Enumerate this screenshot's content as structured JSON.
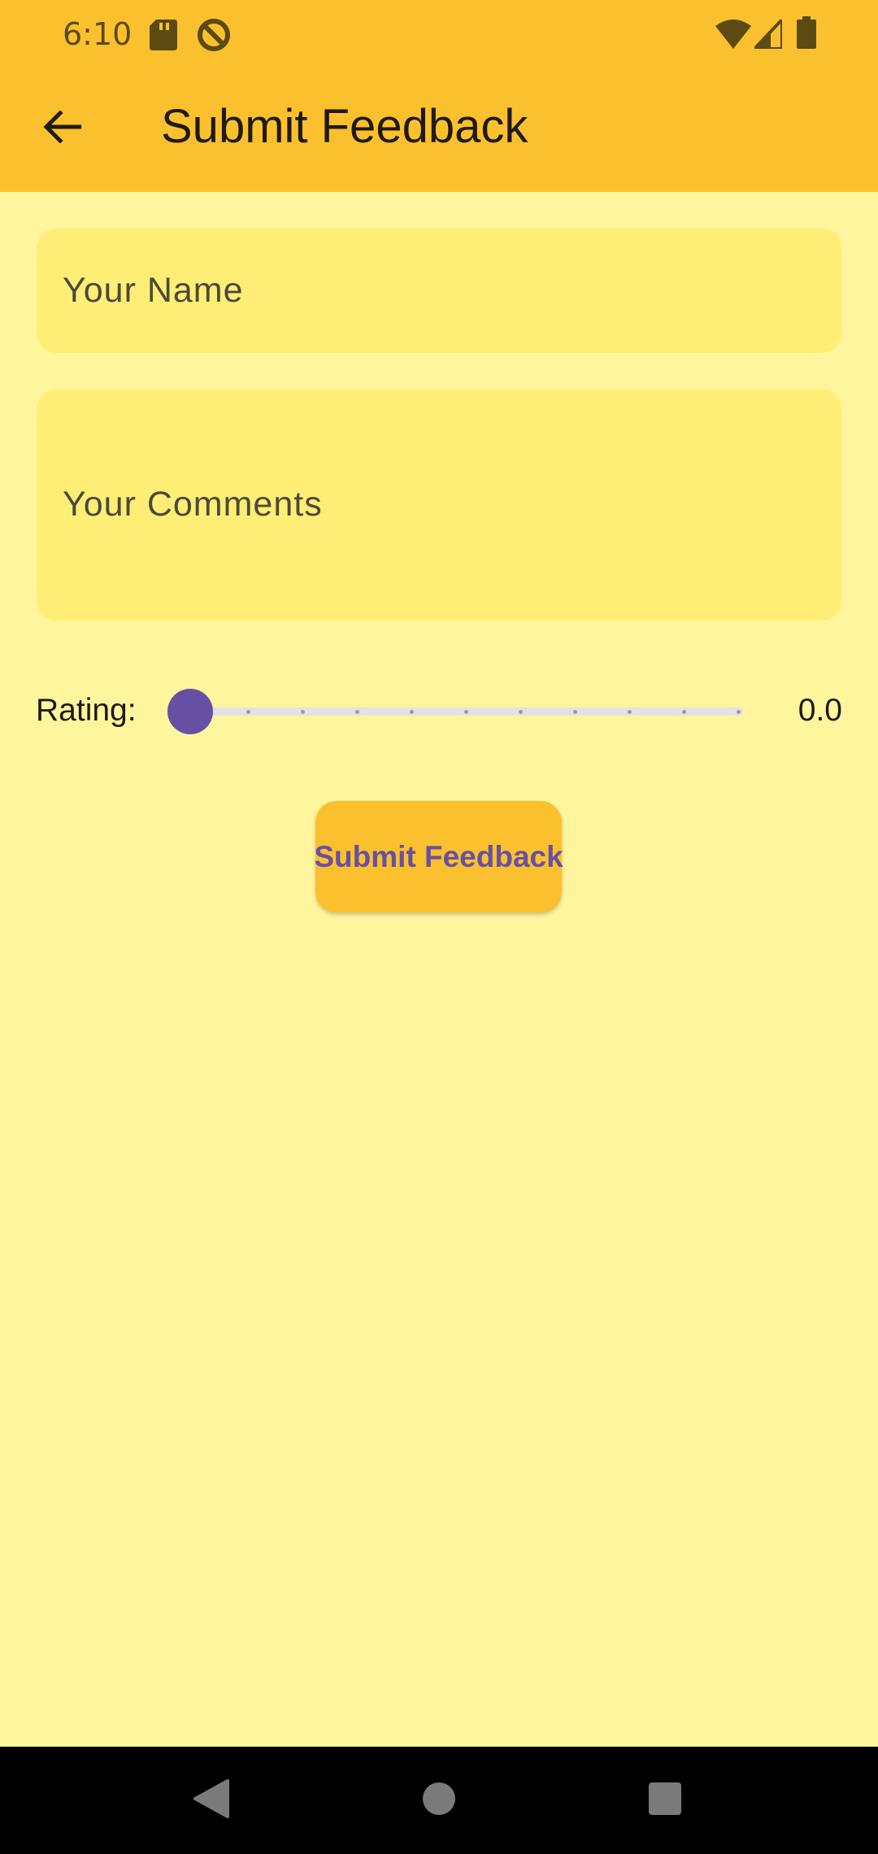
{
  "status_bar": {
    "time": "6:10",
    "icons": [
      "sd-card-icon",
      "do-not-disturb-icon",
      "wifi-icon",
      "signal-icon",
      "battery-icon"
    ]
  },
  "app_bar": {
    "title": "Submit Feedback",
    "back_icon": "arrow-back-icon",
    "background": "#FBC02D"
  },
  "form": {
    "name_placeholder": "Your Name",
    "comments_placeholder": "Your Comments",
    "field_background": "#FFEE75"
  },
  "rating": {
    "label": "Rating:",
    "value_text": "0.0",
    "value": 0.0,
    "min": 0,
    "max": 10,
    "divisions": 10,
    "accent": "#6750A4"
  },
  "submit": {
    "label": "Submit Feedback"
  },
  "page": {
    "background": "#FFF59D"
  },
  "nav_bar": {
    "icons": [
      "back-triangle-icon",
      "home-circle-icon",
      "recents-square-icon"
    ]
  }
}
